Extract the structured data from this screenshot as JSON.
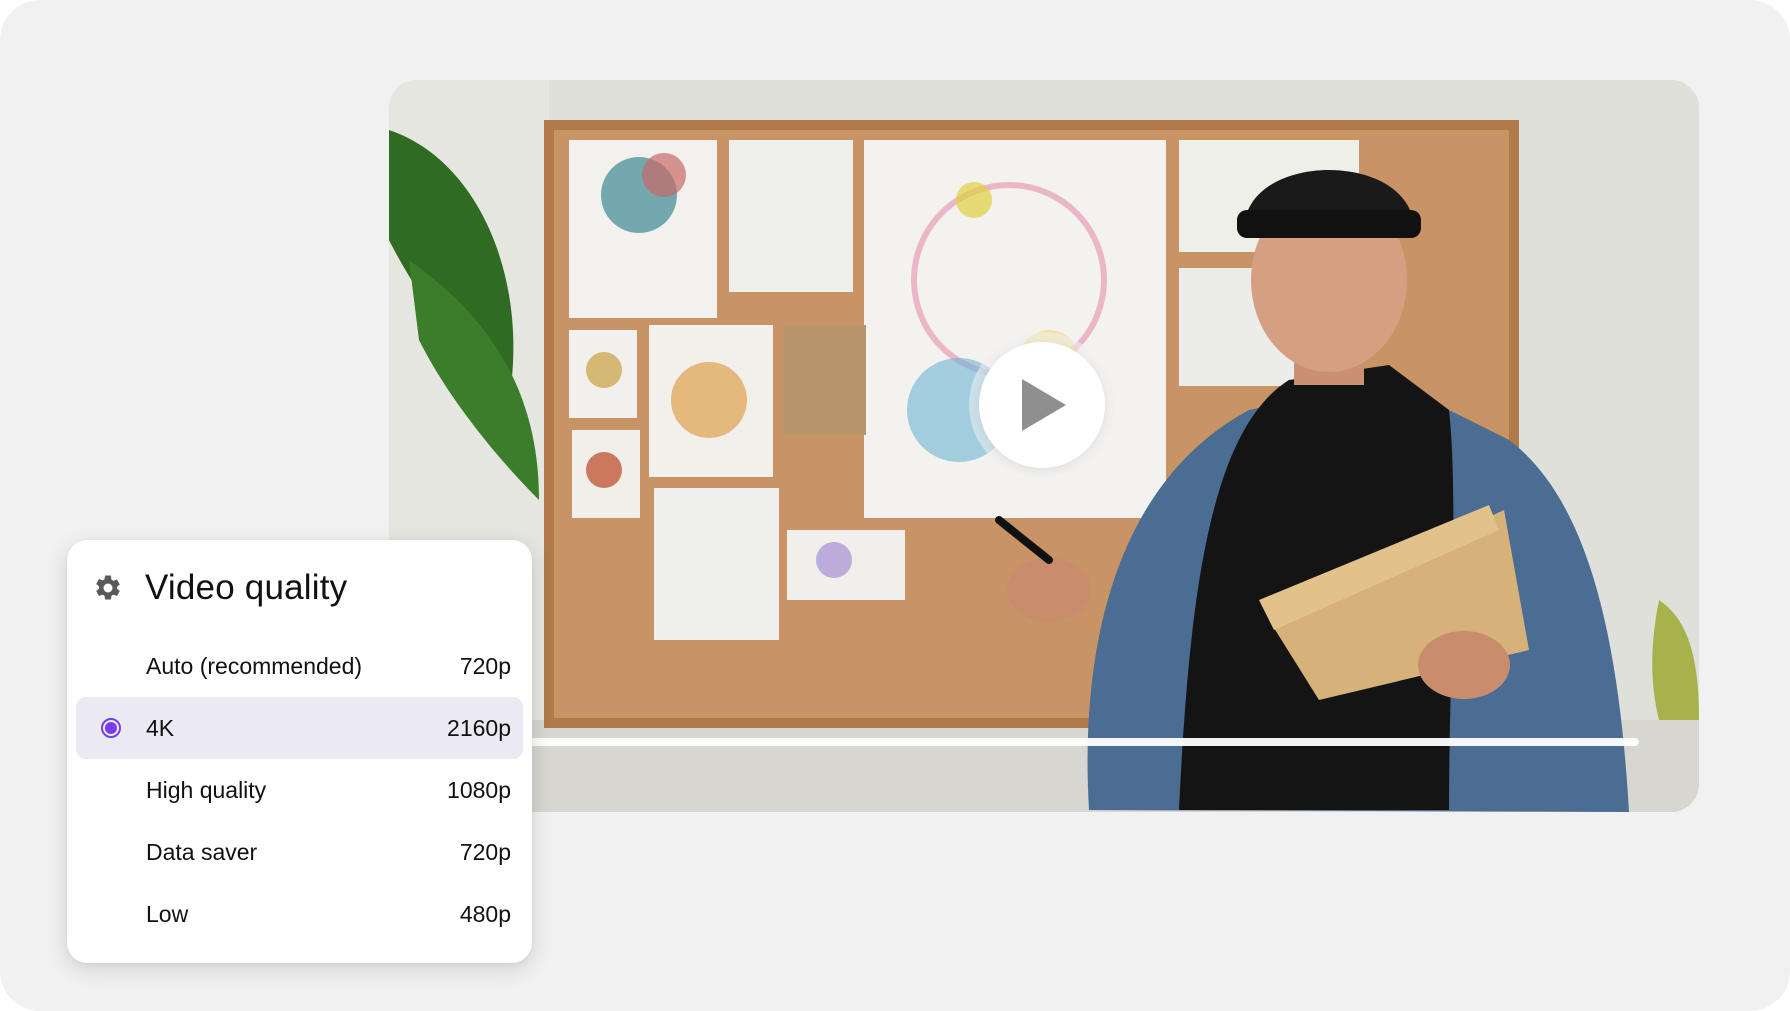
{
  "quality_panel": {
    "title": "Video quality",
    "icon": "gear-icon",
    "options": [
      {
        "label": "Auto (recommended)",
        "resolution": "720p",
        "selected": false
      },
      {
        "label": "4K",
        "resolution": "2160p",
        "selected": true
      },
      {
        "label": "High quality",
        "resolution": "1080p",
        "selected": false
      },
      {
        "label": "Data saver",
        "resolution": "720p",
        "selected": false
      },
      {
        "label": "Low",
        "resolution": "480p",
        "selected": false
      }
    ]
  },
  "player": {
    "play_icon": "play-icon",
    "progress": 1.0
  },
  "colors": {
    "accent": "#7a3ee6",
    "selected_bg": "#ebeaf2",
    "background": "#f1f1f1"
  }
}
